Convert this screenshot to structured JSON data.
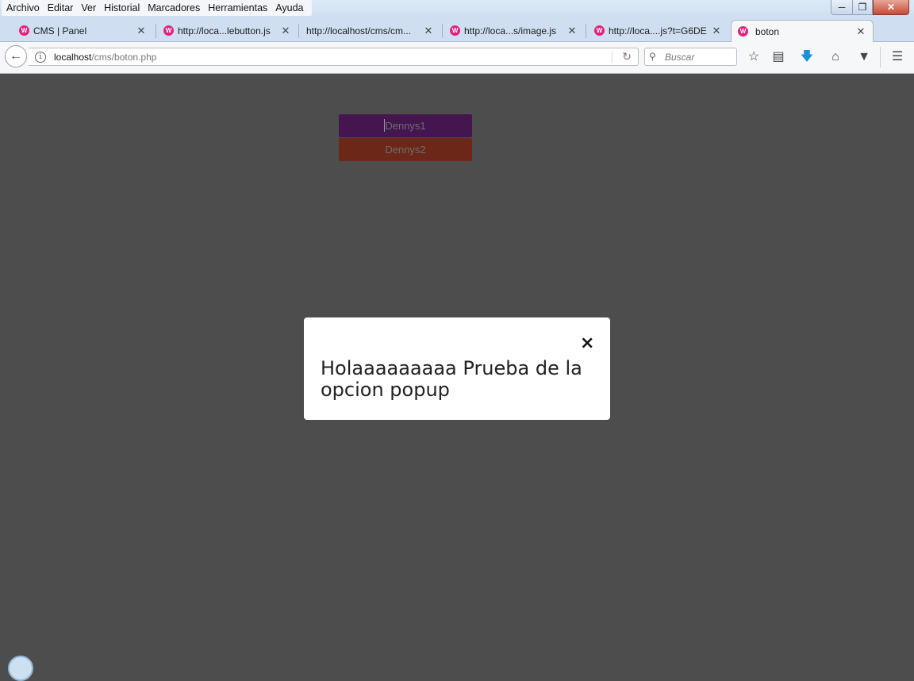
{
  "menubar": {
    "items": [
      "Archivo",
      "Editar",
      "Ver",
      "Historial",
      "Marcadores",
      "Herramientas",
      "Ayuda"
    ]
  },
  "window": {
    "minimize_glyph": "─",
    "maximize_glyph": "❐",
    "close_glyph": "✕"
  },
  "tabs": [
    {
      "label": "CMS | Panel",
      "has_favicon": true
    },
    {
      "label": "http://loca...lebutton.js",
      "has_favicon": true
    },
    {
      "label": "http://localhost/cms/cm...",
      "has_favicon": false
    },
    {
      "label": "http://loca...s/image.js",
      "has_favicon": true
    },
    {
      "label": "http://loca....js?t=G6DE",
      "has_favicon": true
    },
    {
      "label": "boton",
      "has_favicon": true,
      "active": true
    }
  ],
  "tab_close_glyph": "✕",
  "newtab_glyph": "+",
  "navbar": {
    "url_host": "localhost",
    "url_path": "/cms/boton.php",
    "search_placeholder": "Buscar"
  },
  "page": {
    "button_1": {
      "label": "Dennys1",
      "color": "#45154f"
    },
    "button_2": {
      "label": "Dennys2",
      "color": "#6c2719"
    },
    "background": "#4d4d4d"
  },
  "popup": {
    "message": "Holaaaaaaaaa Prueba de la opcion popup",
    "close_glyph": "×"
  }
}
